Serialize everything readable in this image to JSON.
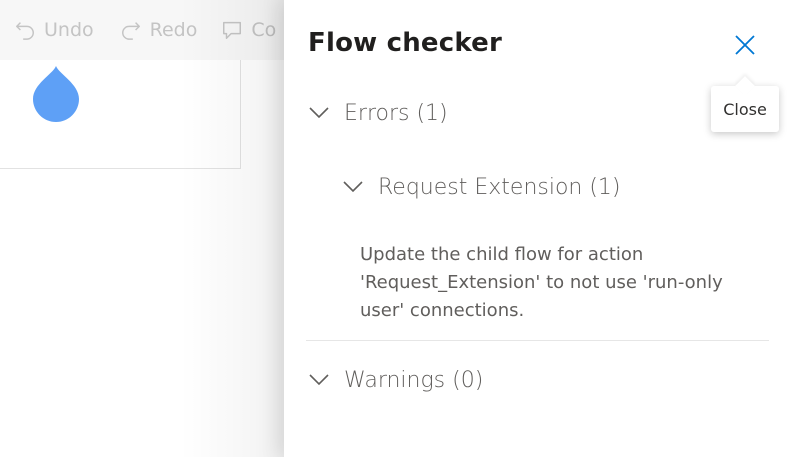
{
  "toolbar": {
    "undo_label": "Undo",
    "redo_label": "Redo",
    "comment_label": "Co"
  },
  "designer": {
    "card_icon": "drop-icon",
    "card_icon_color": "#5ea0f6"
  },
  "panel": {
    "title": "Flow checker",
    "close_tooltip": "Close",
    "accent": "#0078d4",
    "errors": {
      "label": "Errors (1)",
      "items": [
        {
          "label": "Request Extension (1)",
          "message": "Update the child flow for action 'Request_Extension' to not use 'run-only user' connections."
        }
      ]
    },
    "warnings": {
      "label": "Warnings (0)"
    }
  }
}
